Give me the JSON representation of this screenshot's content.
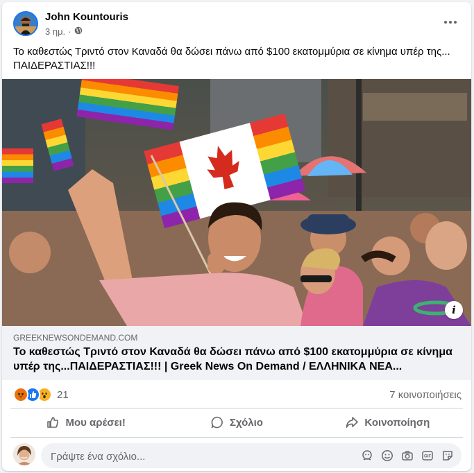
{
  "post": {
    "author": "John Kountouris",
    "time": "3 ημ.",
    "privacy_icon": "globe-icon",
    "text": "Το καθεστώς Τριντό στον Καναδά θα δώσει πάνω από $100 εκατομμύρια σε κίνημα υπέρ της... ΠΑΙΔΕΡΑΣΤΙΑΣ!!!"
  },
  "link": {
    "domain": "GREEKNEWSONDEMAND.COM",
    "title": "Το καθεστώς Τριντό στον Καναδά θα δώσει πάνω από $100 εκατομμύρια σε κίνημα υπέρ της...ΠΑΙΔΕΡΑΣΤΙΑΣ!!! | Greek News On Demand / ΕΛΛΗΝΙΚΑ ΝΕΑ...",
    "info_icon": "i"
  },
  "stats": {
    "reactions": [
      "angry-icon",
      "like-icon",
      "wow-icon"
    ],
    "reaction_count": "21",
    "shares": "7 κοινοποιήσεις"
  },
  "actions": {
    "like": "Μου αρέσει!",
    "comment": "Σχόλιο",
    "share": "Κοινοποίηση"
  },
  "comment": {
    "placeholder": "Γράψτε ένα σχόλιο..."
  },
  "colors": {
    "accent": "#1877f2",
    "angry": "#e9710f",
    "like": "#1877f2",
    "wow": "#f7b125"
  }
}
